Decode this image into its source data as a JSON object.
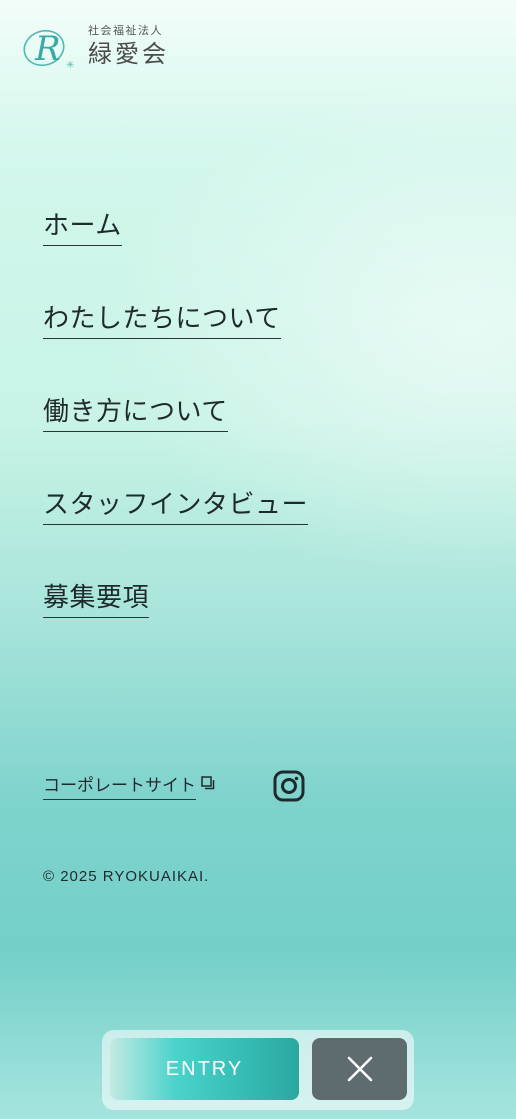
{
  "header": {
    "logo_letter": "R",
    "org_type": "社会福祉法人",
    "org_name": "緑愛会"
  },
  "nav": {
    "items": [
      {
        "label": "ホーム"
      },
      {
        "label": "わたしたちについて"
      },
      {
        "label": "働き方について"
      },
      {
        "label": "スタッフインタビュー"
      },
      {
        "label": "募集要項"
      }
    ]
  },
  "footer": {
    "corporate_site_label": "コーポレートサイト",
    "external_icon": "external-link-icon",
    "social_icon": "instagram-icon",
    "copyright": "© 2025 RYOKUAIKAI."
  },
  "actions": {
    "entry_label": "ENTRY",
    "close_icon": "close-icon"
  },
  "colors": {
    "accent": "#3ec8bf",
    "close_bg": "#5f6c6f",
    "text": "#1f2a2c",
    "logo_teal": "#4fb8b0"
  }
}
